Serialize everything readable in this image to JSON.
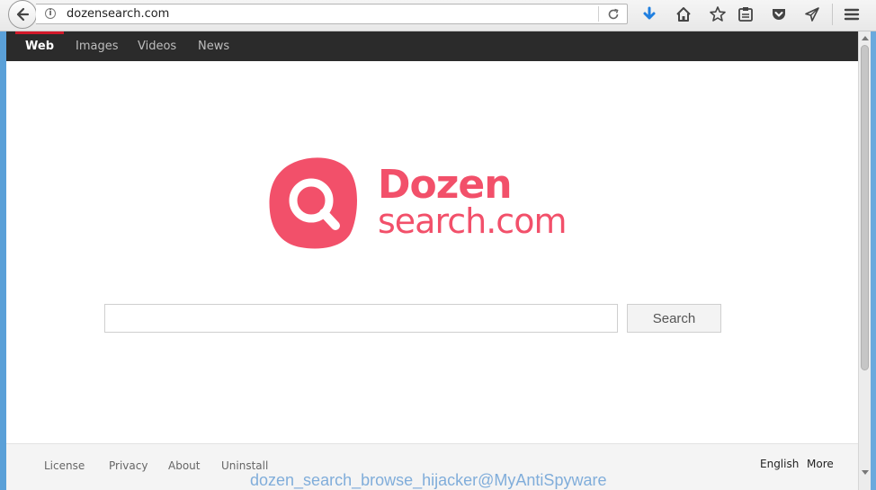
{
  "browser": {
    "url": "dozensearch.com",
    "info_glyph": "i",
    "toolbar_icons": [
      "download-icon",
      "home-icon",
      "bookmark-star-icon",
      "reading-list-icon",
      "pocket-icon",
      "send-icon",
      "menu-icon"
    ],
    "accent_download": "#1f7fe0"
  },
  "site": {
    "nav": [
      "Web",
      "Images",
      "Videos",
      "News"
    ],
    "active_tab": "Web",
    "logo": {
      "line1": "Dozen",
      "line2": "search.com",
      "color": "#f2506a"
    },
    "search": {
      "value": "",
      "placeholder": "",
      "button": "Search"
    },
    "footer": {
      "links": [
        "License",
        "Privacy",
        "About",
        "Uninstall"
      ],
      "language": "English",
      "more": "More"
    }
  },
  "watermark": "dozen_search_browse_hijacker@MyAntiSpyware"
}
